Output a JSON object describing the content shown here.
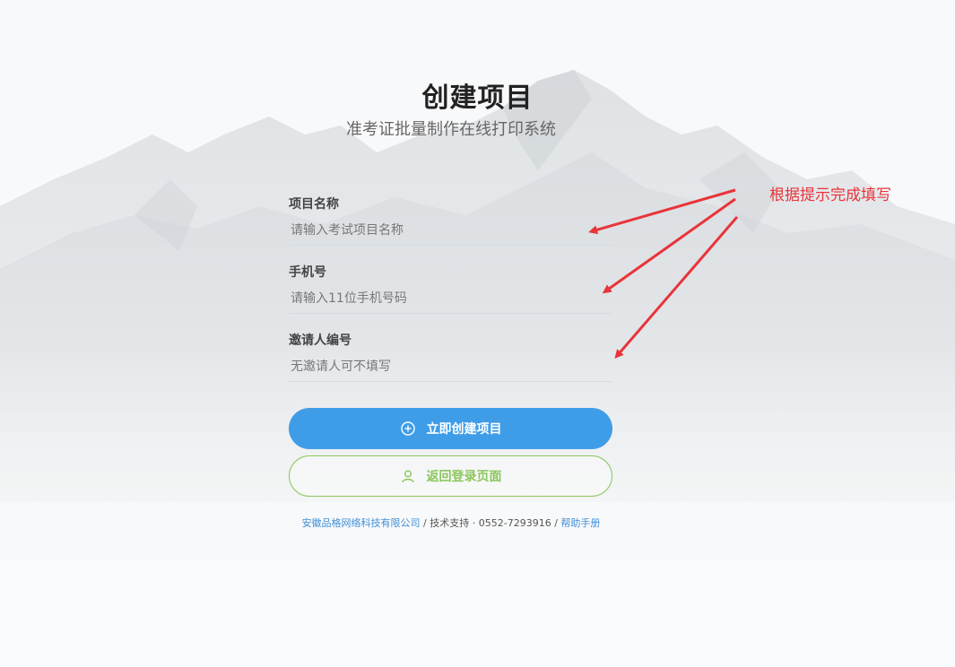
{
  "header": {
    "title": "创建项目",
    "subtitle": "准考证批量制作在线打印系统"
  },
  "form": {
    "fields": [
      {
        "label": "项目名称",
        "placeholder": "请输入考试项目名称",
        "value": ""
      },
      {
        "label": "手机号",
        "placeholder": "请输入11位手机号码",
        "value": ""
      },
      {
        "label": "邀请人编号",
        "placeholder": "无邀请人可不填写",
        "value": ""
      }
    ]
  },
  "actions": {
    "create_label": "立即创建项目",
    "back_label": "返回登录页面"
  },
  "footer": {
    "company": "安徽品格网络科技有限公司",
    "separator1": " / ",
    "support": "技术支持 · 0552-7293916",
    "separator2": " / ",
    "help": "帮助手册"
  },
  "annotation": {
    "text": "根据提示完成填写"
  },
  "colors": {
    "primary": "#3f9de8",
    "secondary": "#8cc65a",
    "annotation": "#e8343a",
    "link": "#3f8fd8"
  },
  "icons": {
    "create": "plus-circle-icon",
    "back": "user-icon",
    "annotation": "arrow-icon"
  }
}
